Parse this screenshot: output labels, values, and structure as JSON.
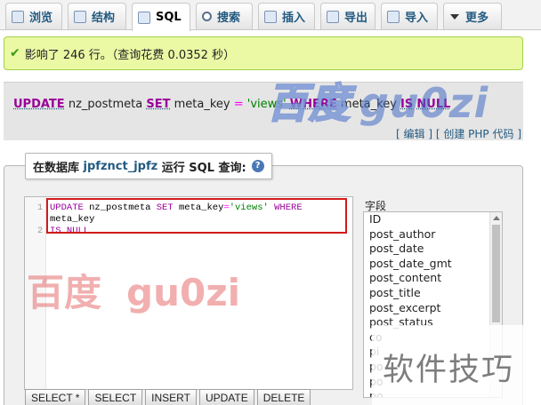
{
  "tabs": [
    {
      "label": "浏览",
      "icon": "browse-icon"
    },
    {
      "label": "结构",
      "icon": "structure-icon"
    },
    {
      "label": "SQL",
      "icon": "sql-icon",
      "active": true
    },
    {
      "label": "搜索",
      "icon": "search-icon"
    },
    {
      "label": "插入",
      "icon": "insert-icon"
    },
    {
      "label": "导出",
      "icon": "export-icon"
    },
    {
      "label": "导入",
      "icon": "import-icon"
    },
    {
      "label": "更多",
      "icon": "chevron-down-icon"
    }
  ],
  "success": {
    "message": "影响了 246 行。（查询花费 0.0352 秒）"
  },
  "query_echo": {
    "kw_update": "UPDATE",
    "table": "nz_postmeta",
    "kw_set": "SET",
    "column": "meta_key",
    "eq": "=",
    "value": "'views'",
    "kw_where": "WHERE",
    "where_col": "meta_key",
    "kw_is": "IS",
    "kw_null": "NULL"
  },
  "links": {
    "edit": "编辑",
    "create_php": "创建 PHP 代码"
  },
  "legend": {
    "prefix": "在数据库",
    "db_name": "jpfznct_jpfz",
    "suffix": "运行 SQL 查询:"
  },
  "editor": {
    "line_numbers": [
      "1",
      "2"
    ],
    "kw_update": "UPDATE",
    "table": "nz_postmeta",
    "kw_set": "SET",
    "column": "meta_key",
    "eq": "=",
    "value": "'views'",
    "kw_where": "WHERE",
    "where_col": "meta_key",
    "kw_is": "IS",
    "kw_null": "NULL"
  },
  "fields_label": "字段",
  "fields": [
    "ID",
    "post_author",
    "post_date",
    "post_date_gmt",
    "post_content",
    "post_title",
    "post_excerpt",
    "post_status",
    "co",
    "pi",
    "po",
    "po",
    "po",
    "to"
  ],
  "buttons": [
    "SELECT *",
    "SELECT",
    "INSERT",
    "UPDATE",
    "DELETE"
  ],
  "watermarks": {
    "blue_cn": "百度",
    "blue_en": "gu0zi",
    "red_cn": "百度",
    "red_en": "gu0zi",
    "corner": "软件技巧"
  }
}
